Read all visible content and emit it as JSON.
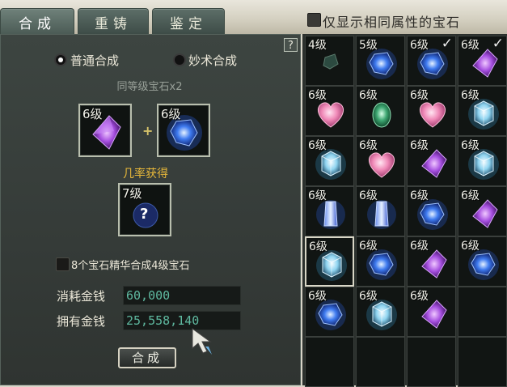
{
  "tabs": [
    {
      "label": "合成",
      "active": true
    },
    {
      "label": "重铸",
      "active": false
    },
    {
      "label": "鉴定",
      "active": false
    }
  ],
  "filter": {
    "label": "仅显示相同属性的宝石",
    "checked": false
  },
  "help_label": "?",
  "mode": {
    "normal_label": "普通合成",
    "skill_label": "妙术合成",
    "selected": "normal"
  },
  "requirement_label": "同等级宝石x2",
  "inputs": [
    {
      "level": "6级",
      "gem": "purple-gem-icon"
    },
    {
      "level": "6级",
      "gem": "blue-gem-icon"
    }
  ],
  "plus_symbol": "+",
  "chance_label": "几率获得",
  "output": {
    "level": "7级",
    "symbol": "?"
  },
  "essence": {
    "label": "8个宝石精华合成4级宝石",
    "checked": false
  },
  "cost": {
    "label": "消耗金钱",
    "value": "60,000"
  },
  "owned": {
    "label": "拥有金钱",
    "value": "25,558,140"
  },
  "compose_button": "合成",
  "colors": {
    "purple_gem": "#a64fe0",
    "blue_gem": "#3f7bf0",
    "pink_gem": "#f08ab8",
    "green_gem": "#3fa873",
    "cyan_gem": "#8fd4f0",
    "money_text": "#5fb9a0",
    "chance_text": "#e8b83a"
  },
  "inventory": [
    {
      "level": "4级",
      "gem": "dark-green-gem-icon",
      "checked": false
    },
    {
      "level": "5级",
      "gem": "blue-gem-icon",
      "checked": false
    },
    {
      "level": "6级",
      "gem": "blue-gem-icon",
      "checked": true
    },
    {
      "level": "6级",
      "gem": "purple-gem-icon",
      "checked": true
    },
    {
      "level": "6级",
      "gem": "pink-heart-gem-icon",
      "checked": false
    },
    {
      "level": "6级",
      "gem": "green-gem-icon",
      "checked": false
    },
    {
      "level": "6级",
      "gem": "pink-heart-gem-icon",
      "checked": false
    },
    {
      "level": "6级",
      "gem": "cyan-cube-gem-icon",
      "checked": false
    },
    {
      "level": "6级",
      "gem": "cyan-cube-gem-icon",
      "checked": false
    },
    {
      "level": "6级",
      "gem": "pink-heart-gem-icon",
      "checked": false
    },
    {
      "level": "6级",
      "gem": "purple-gem-icon",
      "checked": false
    },
    {
      "level": "6级",
      "gem": "cyan-cube-gem-icon",
      "checked": false
    },
    {
      "level": "6级",
      "gem": "blue-crystal-gem-icon",
      "checked": false
    },
    {
      "level": "6级",
      "gem": "blue-crystal-gem-icon",
      "checked": false
    },
    {
      "level": "6级",
      "gem": "blue-gem-icon",
      "checked": false
    },
    {
      "level": "6级",
      "gem": "purple-gem-icon",
      "checked": false
    },
    {
      "level": "6级",
      "gem": "cyan-cube-gem-icon",
      "checked": false
    },
    {
      "level": "6级",
      "gem": "blue-gem-icon",
      "checked": false
    },
    {
      "level": "6级",
      "gem": "purple-gem-icon",
      "checked": false
    },
    {
      "level": "6级",
      "gem": "blue-gem-icon",
      "checked": false
    },
    {
      "level": "6级",
      "gem": "blue-gem-icon",
      "checked": false
    },
    {
      "level": "6级",
      "gem": "cyan-cube-gem-icon",
      "checked": false
    },
    {
      "level": "6级",
      "gem": "purple-gem-icon",
      "checked": false
    },
    {
      "level": "",
      "gem": "",
      "checked": false
    },
    {
      "level": "",
      "gem": "",
      "checked": false
    },
    {
      "level": "",
      "gem": "",
      "checked": false
    },
    {
      "level": "",
      "gem": "",
      "checked": false
    },
    {
      "level": "",
      "gem": "",
      "checked": false
    }
  ],
  "selected_cell": 16
}
